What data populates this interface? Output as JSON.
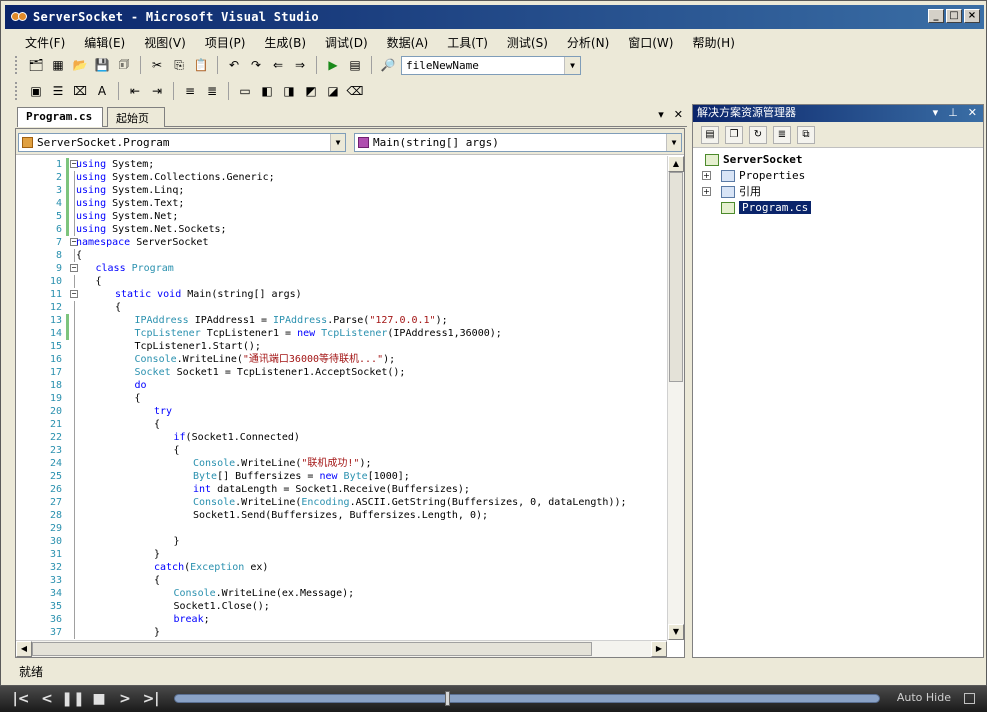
{
  "window": {
    "title": "ServerSocket - Microsoft Visual Studio"
  },
  "menu": [
    "文件(F)",
    "编辑(E)",
    "视图(V)",
    "项目(P)",
    "生成(B)",
    "调试(D)",
    "数据(A)",
    "工具(T)",
    "测试(S)",
    "分析(N)",
    "窗口(W)",
    "帮助(H)"
  ],
  "toolbar": {
    "find_combo_value": "fileNewName"
  },
  "tabs": {
    "active": "Program.cs",
    "other": "起始页"
  },
  "navbar": {
    "class_combo": "ServerSocket.Program",
    "member_combo": "Main(string[] args)"
  },
  "code": {
    "lines": [
      {
        "n": "1",
        "indent": 0,
        "fold": "minus",
        "parts": [
          [
            "kw",
            "using"
          ],
          [
            "",
            "System;"
          ]
        ]
      },
      {
        "n": "2",
        "indent": 0,
        "parts": [
          [
            "kw",
            "using"
          ],
          [
            "",
            "System.Collections.Generic;"
          ]
        ]
      },
      {
        "n": "3",
        "indent": 0,
        "parts": [
          [
            "kw",
            "using"
          ],
          [
            "",
            "System.Linq;"
          ]
        ]
      },
      {
        "n": "4",
        "indent": 0,
        "parts": [
          [
            "kw",
            "using"
          ],
          [
            "",
            "System.Text;"
          ]
        ]
      },
      {
        "n": "5",
        "indent": 0,
        "parts": [
          [
            "kw",
            "using"
          ],
          [
            "",
            "System.Net;"
          ]
        ]
      },
      {
        "n": "6",
        "indent": 0,
        "parts": [
          [
            "kw",
            "using"
          ],
          [
            "",
            "System.Net.Sockets;"
          ]
        ]
      },
      {
        "n": "7",
        "indent": 0,
        "fold": "minus",
        "parts": [
          [
            "kw",
            "namespace"
          ],
          [
            "",
            "ServerSocket"
          ]
        ]
      },
      {
        "n": "8",
        "indent": 0,
        "parts": [
          [
            "",
            "{"
          ]
        ]
      },
      {
        "n": "9",
        "indent": 1,
        "fold": "minus",
        "parts": [
          [
            "kw",
            "class"
          ],
          [
            "ty",
            "Program"
          ]
        ]
      },
      {
        "n": "10",
        "indent": 1,
        "parts": [
          [
            "",
            "{"
          ]
        ]
      },
      {
        "n": "11",
        "indent": 2,
        "fold": "minus",
        "parts": [
          [
            "kw",
            "static void"
          ],
          [
            "",
            "Main(string[] args)"
          ]
        ]
      },
      {
        "n": "12",
        "indent": 2,
        "parts": [
          [
            "",
            "{"
          ]
        ]
      },
      {
        "n": "13",
        "indent": 3,
        "parts": [
          [
            "ty",
            "IPAddress"
          ],
          [
            "",
            "IPAddress1 ="
          ],
          [
            "ty",
            "IPAddress"
          ],
          [
            "",
            ".Parse("
          ],
          [
            "st",
            "\"127.0.0.1\""
          ],
          [
            "",
            ");"
          ]
        ]
      },
      {
        "n": "14",
        "indent": 3,
        "parts": [
          [
            "ty",
            "TcpListener"
          ],
          [
            "",
            "TcpListener1 ="
          ],
          [
            "kw",
            "new"
          ],
          [
            "ty",
            "TcpListener"
          ],
          [
            "",
            "(IPAddress1,36000);"
          ]
        ]
      },
      {
        "n": "15",
        "indent": 3,
        "parts": [
          [
            "",
            "TcpListener1.Start();"
          ]
        ]
      },
      {
        "n": "16",
        "indent": 3,
        "parts": [
          [
            "ty",
            "Console"
          ],
          [
            "",
            ".WriteLine("
          ],
          [
            "st",
            "\"通讯端口36000等待联机...\""
          ],
          [
            "",
            ");"
          ]
        ]
      },
      {
        "n": "17",
        "indent": 3,
        "parts": [
          [
            "ty",
            "Socket"
          ],
          [
            "",
            "Socket1 = TcpListener1.AcceptSocket();"
          ]
        ]
      },
      {
        "n": "18",
        "indent": 3,
        "parts": [
          [
            "kw",
            "do"
          ]
        ]
      },
      {
        "n": "19",
        "indent": 3,
        "parts": [
          [
            "",
            "{"
          ]
        ]
      },
      {
        "n": "20",
        "indent": 4,
        "parts": [
          [
            "kw",
            "try"
          ]
        ]
      },
      {
        "n": "21",
        "indent": 4,
        "parts": [
          [
            "",
            "{"
          ]
        ]
      },
      {
        "n": "22",
        "indent": 5,
        "parts": [
          [
            "kw",
            "if"
          ],
          [
            "",
            "(Socket1.Connected)"
          ]
        ]
      },
      {
        "n": "23",
        "indent": 5,
        "parts": [
          [
            "",
            "{"
          ]
        ]
      },
      {
        "n": "24",
        "indent": 6,
        "parts": [
          [
            "ty",
            "Console"
          ],
          [
            "",
            ".WriteLine("
          ],
          [
            "st",
            "\"联机成功!\""
          ],
          [
            "",
            ");"
          ]
        ]
      },
      {
        "n": "25",
        "indent": 6,
        "parts": [
          [
            "ty",
            "Byte"
          ],
          [
            "",
            "[] Buffersizes ="
          ],
          [
            "kw",
            "new"
          ],
          [
            "ty",
            "Byte"
          ],
          [
            "",
            "[1000];"
          ]
        ]
      },
      {
        "n": "26",
        "indent": 6,
        "parts": [
          [
            "kw",
            "int"
          ],
          [
            "",
            "dataLength = Socket1.Receive(Buffersizes);"
          ]
        ]
      },
      {
        "n": "27",
        "indent": 6,
        "parts": [
          [
            "ty",
            "Console"
          ],
          [
            "",
            ".WriteLine("
          ],
          [
            "ty",
            "Encoding"
          ],
          [
            "",
            ".ASCII.GetString(Buffersizes, 0, dataLength));"
          ]
        ]
      },
      {
        "n": "28",
        "indent": 6,
        "parts": [
          [
            "",
            "Socket1.Send(Buffersizes, Buffersizes.Length, 0);"
          ]
        ]
      },
      {
        "n": "29",
        "indent": 6,
        "parts": [
          [
            "",
            ""
          ]
        ]
      },
      {
        "n": "30",
        "indent": 5,
        "parts": [
          [
            "",
            "}"
          ]
        ]
      },
      {
        "n": "31",
        "indent": 4,
        "parts": [
          [
            "",
            "}"
          ]
        ]
      },
      {
        "n": "32",
        "indent": 4,
        "parts": [
          [
            "kw",
            "catch"
          ],
          [
            "",
            "("
          ],
          [
            "ty",
            "Exception"
          ],
          [
            "",
            "ex)"
          ]
        ]
      },
      {
        "n": "33",
        "indent": 4,
        "parts": [
          [
            "",
            "{"
          ]
        ]
      },
      {
        "n": "34",
        "indent": 5,
        "parts": [
          [
            "ty",
            "Console"
          ],
          [
            "",
            ".WriteLine(ex.Message);"
          ]
        ]
      },
      {
        "n": "35",
        "indent": 5,
        "parts": [
          [
            "",
            "Socket1.Close();"
          ]
        ]
      },
      {
        "n": "36",
        "indent": 5,
        "parts": [
          [
            "kw",
            "break"
          ],
          [
            "",
            ";"
          ]
        ]
      },
      {
        "n": "37",
        "indent": 4,
        "parts": [
          [
            "",
            "}"
          ]
        ]
      }
    ]
  },
  "solution_explorer": {
    "title": "解决方案资源管理器",
    "project": "ServerSocket",
    "items": [
      "Properties",
      "引用",
      "Program.cs"
    ]
  },
  "status": {
    "text": "就绪"
  },
  "player": {
    "auto_hide_label": "Auto Hide"
  },
  "colors": {
    "keyword": "#0000ff",
    "type": "#2b91af",
    "string": "#a31515",
    "title_bar": "#0a246a",
    "selection": "#0a246a"
  }
}
